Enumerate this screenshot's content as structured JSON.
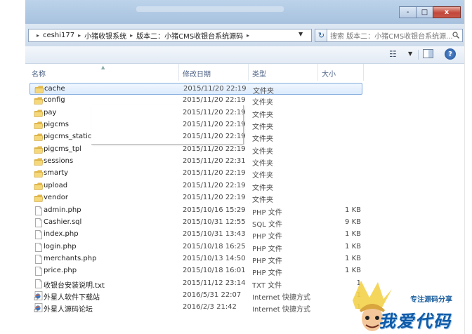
{
  "window": {
    "caption_buttons": [
      "-",
      "□",
      "x"
    ]
  },
  "address_bar": {
    "crumbs": [
      "ceshi177",
      "小猪收银系统",
      "版本二：小猪CMS收银台系统源码"
    ]
  },
  "search": {
    "placeholder": "搜索 版本二：小猪CMS收银台系统源..."
  },
  "toolbar": {
    "views_icon": "view-options-icon",
    "help_label": "?"
  },
  "columns": {
    "name": "名称",
    "date": "修改日期",
    "type": "类型",
    "size": "大小"
  },
  "files": [
    {
      "name": "cache",
      "date": "2015/11/20 22:19",
      "type": "文件夹",
      "size": "",
      "icon": "folder-icon"
    },
    {
      "name": "config",
      "date": "2015/11/20 22:19",
      "type": "文件夹",
      "size": "",
      "icon": "folder-icon"
    },
    {
      "name": "pay",
      "date": "2015/11/20 22:19",
      "type": "文件夹",
      "size": "",
      "icon": "folder-icon"
    },
    {
      "name": "pigcms",
      "date": "2015/11/20 22:19",
      "type": "文件夹",
      "size": "",
      "icon": "folder-icon"
    },
    {
      "name": "pigcms_static",
      "date": "2015/11/20 22:19",
      "type": "文件夹",
      "size": "",
      "icon": "folder-icon"
    },
    {
      "name": "pigcms_tpl",
      "date": "2015/11/20 22:19",
      "type": "文件夹",
      "size": "",
      "icon": "folder-icon"
    },
    {
      "name": "sessions",
      "date": "2015/11/20 22:31",
      "type": "文件夹",
      "size": "",
      "icon": "folder-icon"
    },
    {
      "name": "smarty",
      "date": "2015/11/20 22:19",
      "type": "文件夹",
      "size": "",
      "icon": "folder-icon"
    },
    {
      "name": "upload",
      "date": "2015/11/20 22:19",
      "type": "文件夹",
      "size": "",
      "icon": "folder-icon"
    },
    {
      "name": "vendor",
      "date": "2015/11/20 22:19",
      "type": "文件夹",
      "size": "",
      "icon": "folder-icon"
    },
    {
      "name": "admin.php",
      "date": "2015/10/16 15:29",
      "type": "PHP 文件",
      "size": "1 KB",
      "icon": "file-icon"
    },
    {
      "name": "Cashier.sql",
      "date": "2015/10/31 12:55",
      "type": "SQL 文件",
      "size": "9 KB",
      "icon": "file-icon"
    },
    {
      "name": "index.php",
      "date": "2015/10/31 13:43",
      "type": "PHP 文件",
      "size": "1 KB",
      "icon": "file-icon"
    },
    {
      "name": "login.php",
      "date": "2015/10/18 16:25",
      "type": "PHP 文件",
      "size": "1 KB",
      "icon": "file-icon"
    },
    {
      "name": "merchants.php",
      "date": "2015/10/13 14:50",
      "type": "PHP 文件",
      "size": "1 KB",
      "icon": "file-icon"
    },
    {
      "name": "price.php",
      "date": "2015/10/18 16:01",
      "type": "PHP 文件",
      "size": "1 KB",
      "icon": "file-icon"
    },
    {
      "name": "收银台安装说明.txt",
      "date": "2015/11/12 23:14",
      "type": "TXT 文件",
      "size": "1",
      "icon": "file-icon"
    },
    {
      "name": "外星人软件下载站",
      "date": "2016/5/31 22:07",
      "type": "Internet 快捷方式",
      "size": "1",
      "icon": "internet-shortcut-icon"
    },
    {
      "name": "外星人源码论坛",
      "date": "2016/2/3 21:42",
      "type": "Internet 快捷方式",
      "size": "1",
      "icon": "internet-shortcut-icon"
    }
  ],
  "selected_index": 0,
  "watermark": {
    "slogan": "专注源码分享",
    "main": "我爱代码"
  }
}
